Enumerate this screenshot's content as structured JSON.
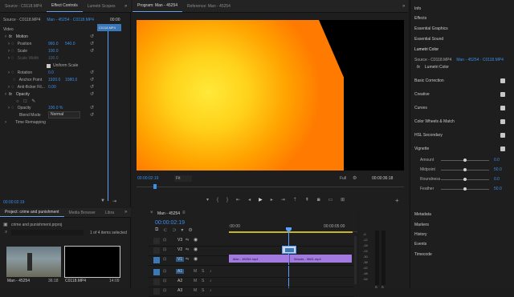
{
  "effect_controls": {
    "tabs": [
      "Source : C0118.MP4",
      "Effect Controls",
      "Lumetri Scopes"
    ],
    "source_select": "Source · C0118.MP4",
    "sequence_select": "Man - 45254 · C0118.MP4",
    "timecode_head": "00:00",
    "clip_label": "C0118.MP4",
    "video_heading": "Video",
    "motion": "Motion",
    "position_label": "Position",
    "position_x": "960.0",
    "position_y": "540.0",
    "scale_label": "Scale",
    "scale_value": "100.0",
    "scale_width_label": "Scale Width",
    "scale_width_value": "100.0",
    "uniform_scale": "Uniform Scale",
    "rotation_label": "Rotation",
    "rotation_value": "0.0",
    "anchor_label": "Anchor Point",
    "anchor_x": "1920.0",
    "anchor_y": "1080.0",
    "antiflicker_label": "Anti-flicker Fil...",
    "antiflicker_value": "0.00",
    "opacity_heading": "Opacity",
    "opacity_label": "Opacity",
    "opacity_value": "100.0 %",
    "blend_label": "Blend Mode",
    "blend_value": "Normal",
    "time_remap": "Time Remapping",
    "bottom_timecode": "00:00:02:19"
  },
  "program": {
    "tabs": [
      "Program: Man - 45254",
      "Reference: Man - 45254"
    ],
    "current_time": "00:00:02:19",
    "fit": "Fit",
    "quality": "Full",
    "duration": "00:00:36:18"
  },
  "right_panel": {
    "top_items": [
      "Info",
      "Effects",
      "Essential Graphics",
      "Essential Sound",
      "Lumetri Color"
    ],
    "source_line": "Source - C0118.MP4",
    "sequence_line": "Man - 45254 · C0118.MP4",
    "effect_name": "Lumetri Color",
    "sections": [
      "Basic Correction",
      "Creative",
      "Curves",
      "Color Wheels & Match",
      "HSL Secondary",
      "Vignette"
    ],
    "vignette_controls": [
      {
        "label": "Amount",
        "value": "0.0",
        "level": 0.5
      },
      {
        "label": "Midpoint",
        "value": "50.0",
        "level": 0.5
      },
      {
        "label": "Roundness",
        "value": "0.0",
        "level": 0.5
      },
      {
        "label": "Feather",
        "value": "50.0",
        "level": 0.5
      }
    ],
    "bottom_items": [
      "Metadata",
      "Markers",
      "History",
      "Events",
      "Timecode"
    ]
  },
  "project": {
    "tabs": [
      "Project: crime and punishment",
      "Media Browser",
      "Libra"
    ],
    "file_name": "crime and punishment.prproj",
    "items_selected": "1 of 4 items selected",
    "thumb1_name": "Man - 45254",
    "thumb1_duration": "36:18",
    "thumb2_name": "C0118.MP4",
    "thumb2_duration": "14:09"
  },
  "timeline": {
    "tab": "Man - 45254",
    "timecode": "00:00:02:19",
    "ruler": [
      ":00:00",
      "00:00:05:00"
    ],
    "video_tracks": [
      "V3",
      "V2",
      "V1"
    ],
    "audio_tracks": [
      "A1",
      "A2",
      "A3"
    ],
    "track_letters": {
      "m": "M",
      "s": "S"
    },
    "clip_main": "Man - 45254.mp4",
    "clip_second": "Woods - 9661.mp4",
    "meter_labels": [
      "-6",
      "-12",
      "-18",
      "-24",
      "-30",
      "-36",
      "-42",
      "-48",
      "-54"
    ]
  },
  "colors": {
    "accent": "#3d8ee8",
    "clip": "#a37be0",
    "playhead": "#5aa0ff"
  }
}
